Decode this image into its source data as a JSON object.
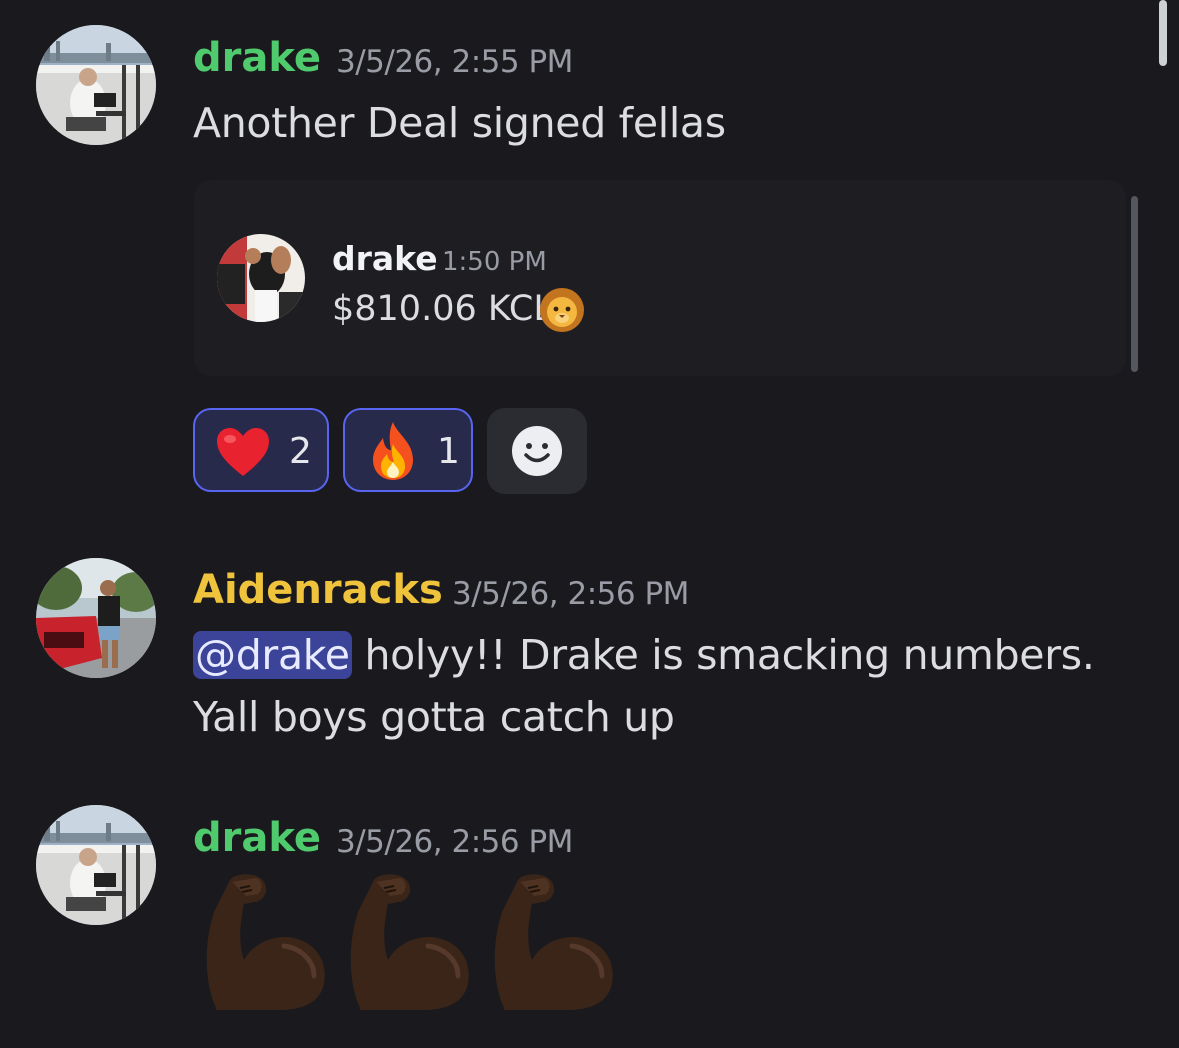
{
  "messages": [
    {
      "username": "drake",
      "username_color": "#4fca6c",
      "timestamp": "3/5/26, 2:55 PM",
      "text": "Another Deal signed fellas",
      "forward_mark": "„ „",
      "forwarded": {
        "username": "drake",
        "time": "1:50 PM",
        "text": "$810.06 KCL",
        "emoji": "lion-face-icon"
      },
      "reactions": [
        {
          "emoji": "red-heart-icon",
          "count": "2"
        },
        {
          "emoji": "fire-icon",
          "count": "1"
        }
      ],
      "add_reaction_icon": "add-reaction-smiley-icon"
    },
    {
      "username": "Aidenracks",
      "username_color": "#f0c33c",
      "timestamp": "3/5/26, 2:56 PM",
      "mention": "@drake",
      "text_line1": " holyy!! Drake is smacking numbers.",
      "text_line2": "Yall boys gotta catch up"
    },
    {
      "username": "drake",
      "username_color": "#4fca6c",
      "timestamp": "3/5/26, 2:56 PM",
      "emojis": [
        "flexed-biceps-icon",
        "flexed-biceps-icon",
        "flexed-biceps-icon"
      ]
    }
  ],
  "colors": {
    "background": "#1a1a1e",
    "accent": "#5865f2"
  }
}
